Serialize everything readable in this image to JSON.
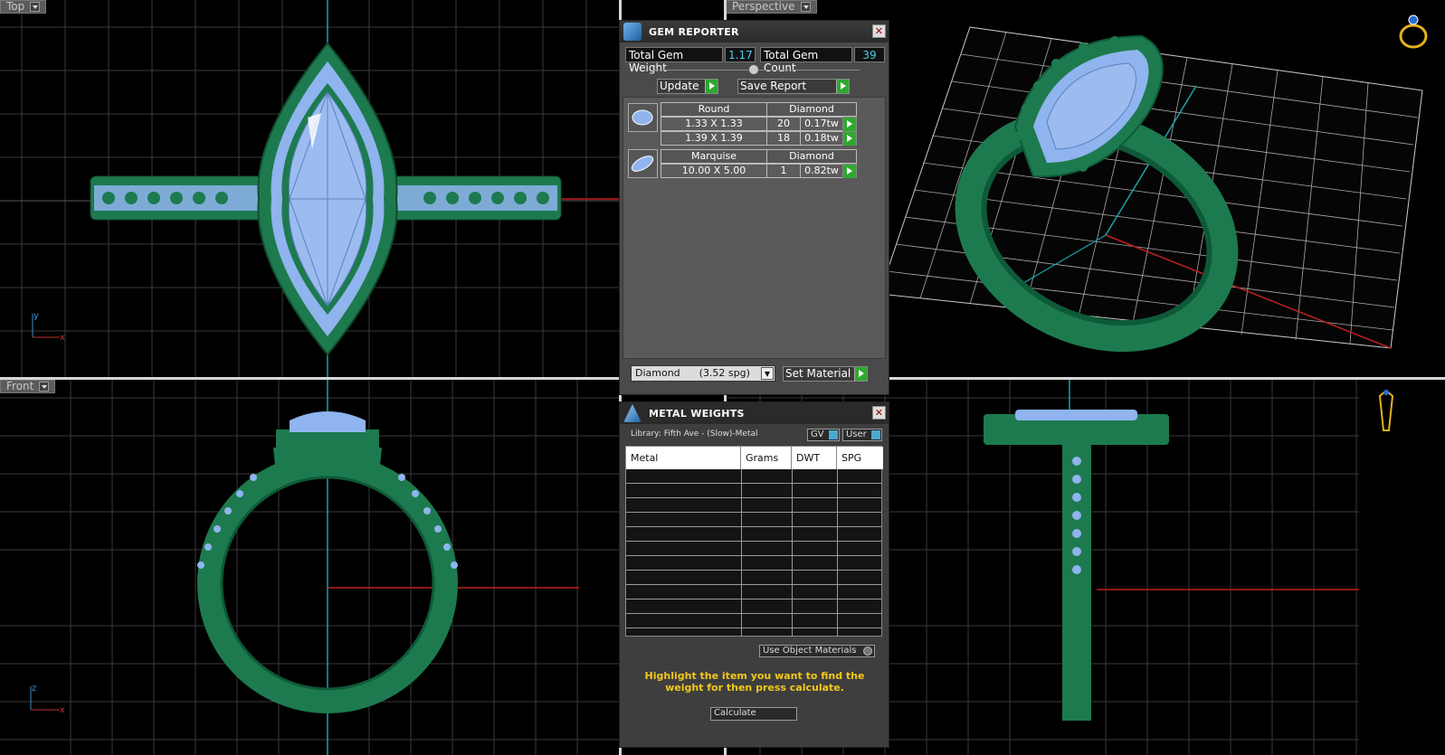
{
  "viewports": {
    "top": {
      "label": "Top",
      "axis_x": "x",
      "axis_y": "y"
    },
    "perspective": {
      "label": "Perspective"
    },
    "front": {
      "label": "Front",
      "axis_x": "x",
      "axis_y": "z"
    }
  },
  "gem_reporter": {
    "title": "GEM REPORTER",
    "total_weight_label": "Total Gem Weight",
    "total_weight_value": "1.17",
    "total_count_label": "Total Gem Count",
    "total_count_value": "39",
    "update_label": "Update",
    "save_report_label": "Save Report",
    "groups": [
      {
        "shape": "Round",
        "material": "Diamond",
        "rows": [
          {
            "size": "1.33 X 1.33",
            "count": "20",
            "weight": "0.17tw"
          },
          {
            "size": "1.39 X 1.39",
            "count": "18",
            "weight": "0.18tw"
          }
        ]
      },
      {
        "shape": "Marquise",
        "material": "Diamond",
        "rows": [
          {
            "size": "10.00 X 5.00",
            "count": "1",
            "weight": "0.82tw"
          }
        ]
      }
    ],
    "material_select": "Diamond      (3.52 spg)",
    "set_material_label": "Set Material"
  },
  "metal_weights": {
    "title": "METAL WEIGHTS",
    "library": "Library: Fifth Ave - (Slow)-Metal",
    "gv_label": "GV",
    "user_label": "User",
    "columns": [
      "Metal",
      "Grams",
      "DWT",
      "SPG"
    ],
    "use_object_materials": "Use Object Materials",
    "hint": "Highlight the item you want to find the weight for then press calculate.",
    "calculate_label": "Calculate"
  },
  "colors": {
    "metal_green": "#1f7a4f",
    "gem_blue": "#8fb4ee",
    "grid": "#3c3c3c",
    "accent_cyan": "#4ad0e8",
    "hint_yellow": "#f2c81c"
  }
}
